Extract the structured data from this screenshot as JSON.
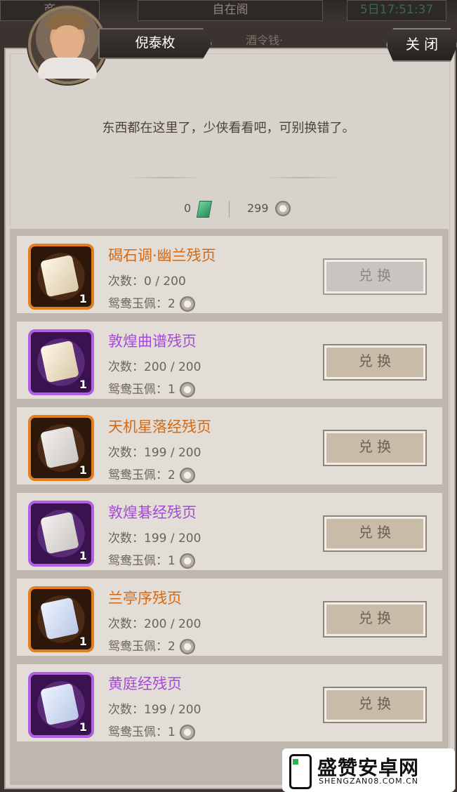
{
  "top_bar": {
    "left": "商",
    "center": "自在阁",
    "time": "5日17:51:37"
  },
  "npc": {
    "name": "倪泰枚"
  },
  "behind_text": "酒令钱·",
  "close_label": "关 闭",
  "dialog": "东西都在这里了，少侠看看吧，可别换错了。",
  "currency": {
    "jade_amount": "0",
    "coin_amount": "299"
  },
  "items": [
    {
      "name": "碣石调·幽兰残页",
      "count_label": "次数：",
      "count": "0 / 200",
      "cost_label": "鸳鸯玉佩：",
      "cost": "2",
      "qty": "1",
      "rarity": "orange",
      "button": "兑 换",
      "button_state": "disabled"
    },
    {
      "name": "敦煌曲谱残页",
      "count_label": "次数：",
      "count": "200 / 200",
      "cost_label": "鸳鸯玉佩：",
      "cost": "1",
      "qty": "1",
      "rarity": "purple",
      "button": "兑 换",
      "button_state": "active"
    },
    {
      "name": "天机星落经残页",
      "count_label": "次数：",
      "count": "199 / 200",
      "cost_label": "鸳鸯玉佩：",
      "cost": "2",
      "qty": "1",
      "rarity": "orange",
      "button": "兑 换",
      "button_state": "active"
    },
    {
      "name": "敦煌碁经残页",
      "count_label": "次数：",
      "count": "199 / 200",
      "cost_label": "鸳鸯玉佩：",
      "cost": "1",
      "qty": "1",
      "rarity": "purple",
      "button": "兑 换",
      "button_state": "active"
    },
    {
      "name": "兰亭序残页",
      "count_label": "次数：",
      "count": "200 / 200",
      "cost_label": "鸳鸯玉佩：",
      "cost": "2",
      "qty": "1",
      "rarity": "orange",
      "button": "兑 换",
      "button_state": "active"
    },
    {
      "name": "黄庭经残页",
      "count_label": "次数：",
      "count": "199 / 200",
      "cost_label": "鸳鸯玉佩：",
      "cost": "1",
      "qty": "1",
      "rarity": "purple",
      "button": "兑 换",
      "button_state": "active"
    }
  ],
  "watermark": {
    "title": "盛赞安卓网",
    "sub": "SHENGZAN08.COM.CN"
  }
}
